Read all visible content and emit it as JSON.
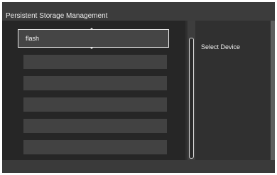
{
  "window": {
    "title": "Persistent Storage Management"
  },
  "device_list": {
    "selected_index": 0,
    "items": [
      {
        "label": "flash"
      },
      {
        "label": ""
      },
      {
        "label": ""
      },
      {
        "label": ""
      },
      {
        "label": ""
      },
      {
        "label": ""
      }
    ]
  },
  "detail": {
    "label": "Select Device"
  },
  "colors": {
    "background": "#2f2f2f",
    "item": "#424242",
    "selection_border": "#e8e8e8",
    "text": "#f2f2f2"
  }
}
